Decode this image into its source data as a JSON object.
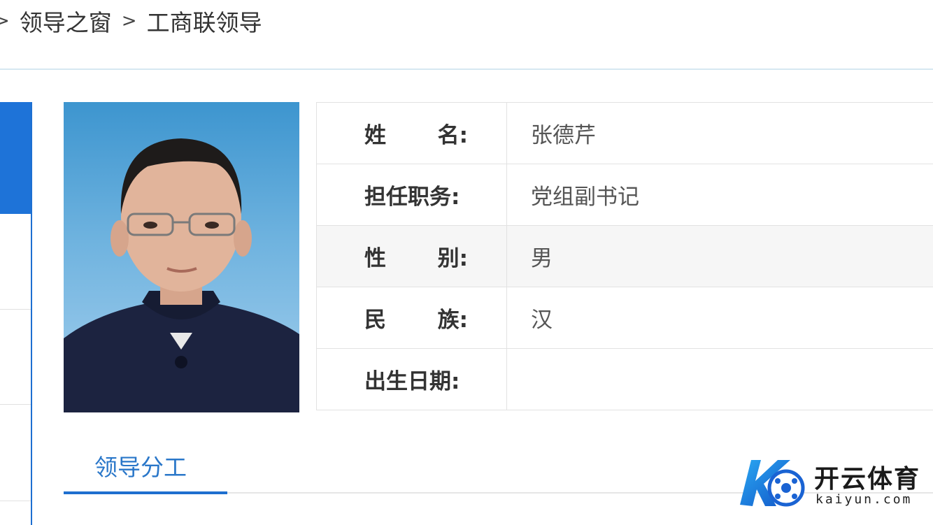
{
  "breadcrumb": {
    "separator": ">",
    "items": [
      "领导之窗",
      "工商联领导"
    ]
  },
  "profile": {
    "rows": [
      {
        "label_chars": [
          "姓",
          "名:"
        ],
        "value": "张德芹"
      },
      {
        "label": "担任职务:",
        "value": "党组副书记"
      },
      {
        "label_chars": [
          "性",
          "别:"
        ],
        "value": "男"
      },
      {
        "label_chars": [
          "民",
          "族:"
        ],
        "value": "汉"
      },
      {
        "label": "出生日期:",
        "value": ""
      }
    ]
  },
  "tabs": [
    {
      "label": "领导分工",
      "active": true
    }
  ],
  "watermark": {
    "text": "开云体育",
    "url": "kaiyun.com"
  },
  "colors": {
    "accent": "#1e73d8",
    "tab_text": "#2a77c9",
    "photo_bg_top": "#3d95cf",
    "photo_bg_bottom": "#a6d0ee",
    "jacket": "#1c2340"
  }
}
